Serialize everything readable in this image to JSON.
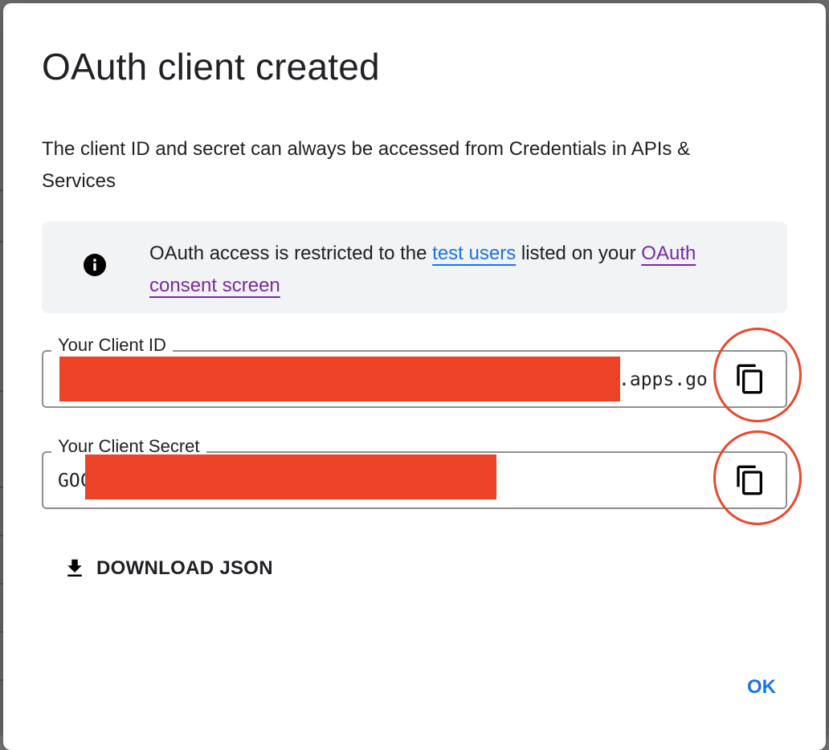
{
  "dialog": {
    "title": "OAuth client created",
    "description": "The client ID and secret can always be accessed from Credentials in APIs & Services"
  },
  "info_notice": {
    "text_before": "OAuth access is restricted to the ",
    "link_test_users": "test users",
    "text_middle": " listed on your ",
    "link_consent_screen": "OAuth consent screen",
    "icon": "info-icon"
  },
  "client_id": {
    "label": "Your Client ID",
    "value_visible_prefix": "(",
    "value_visible_suffix": ".apps.go",
    "copy_icon": "copy-icon"
  },
  "client_secret": {
    "label": "Your Client Secret",
    "value_visible_prefix": "GOC",
    "copy_icon": "copy-icon"
  },
  "download": {
    "label": "DOWNLOAD JSON",
    "icon": "download-icon"
  },
  "actions": {
    "ok_label": "OK"
  },
  "colors": {
    "primary_blue": "#1a73e8",
    "visited_purple": "#7b28a8",
    "redaction_red": "#ec4326",
    "annotation_circle": "#e8482e",
    "notice_bg": "#f1f3f4",
    "text": "#202124"
  }
}
